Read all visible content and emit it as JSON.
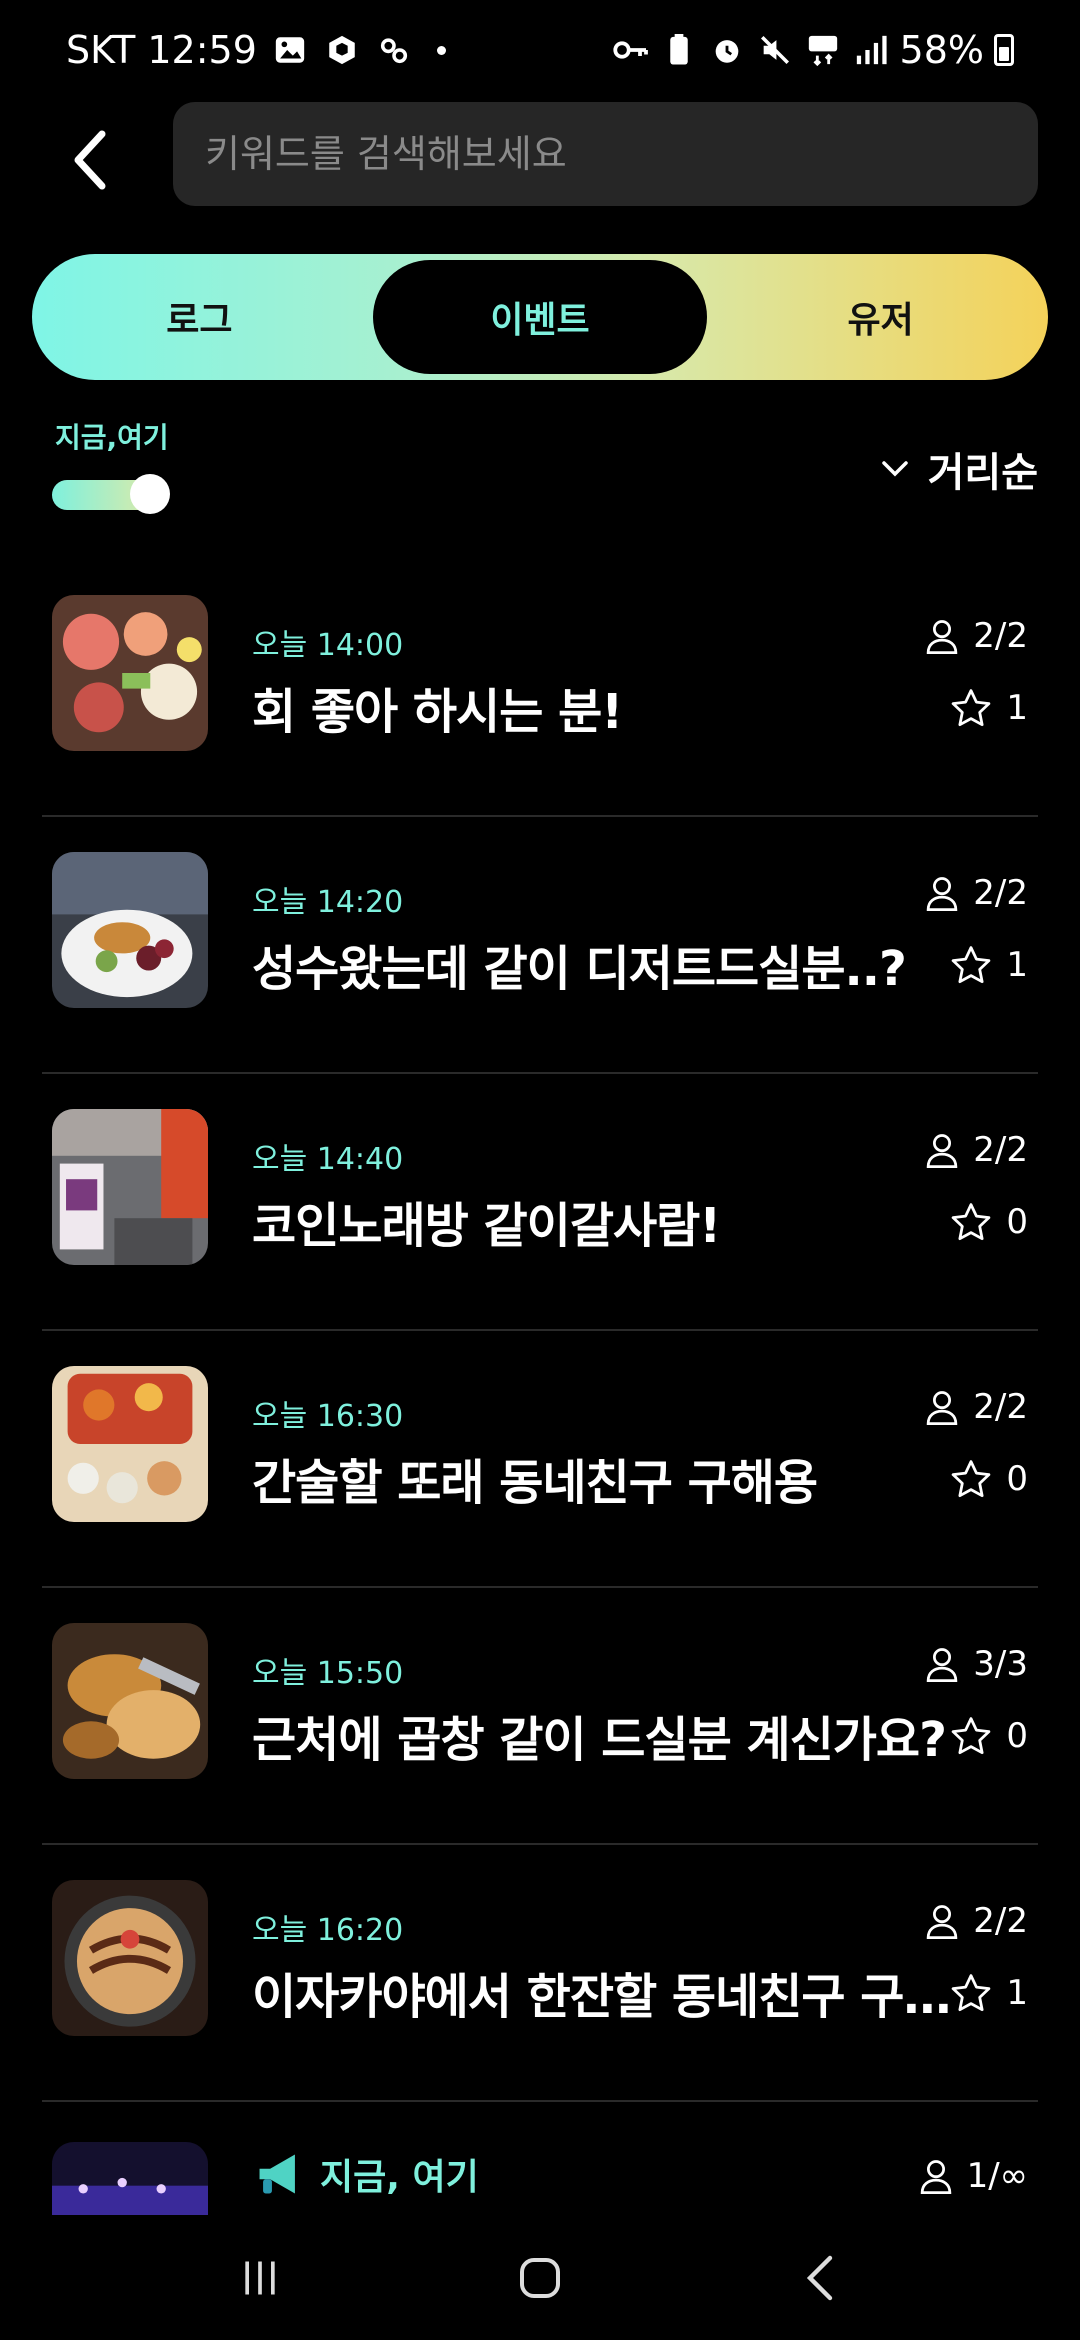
{
  "status_bar": {
    "carrier_time": "SKT 12:59",
    "battery": "58%"
  },
  "search": {
    "placeholder": "키워드를 검색해보세요"
  },
  "tabs": [
    {
      "label": "로그"
    },
    {
      "label": "이벤트",
      "active": true
    },
    {
      "label": "유저"
    }
  ],
  "filter": {
    "now_label": "지금,여기",
    "sort_label": "거리순"
  },
  "colors": {
    "accent": "#7ff0dd",
    "gradient_end": "#f4d25a"
  },
  "events": [
    {
      "time": "오늘 14:00",
      "title": "회 좋아 하시는 분!",
      "people": "2/2",
      "likes": "1"
    },
    {
      "time": "오늘 14:20",
      "title": "성수왔는데 같이 디저트드실분..?",
      "people": "2/2",
      "likes": "1"
    },
    {
      "time": "오늘 14:40",
      "title": "코인노래방 같이갈사람!",
      "people": "2/2",
      "likes": "0"
    },
    {
      "time": "오늘 16:30",
      "title": "간술할 또래 동네친구 구해용",
      "people": "2/2",
      "likes": "0"
    },
    {
      "time": "오늘 15:50",
      "title": "근처에 곱창 같이 드실분 계신가요?",
      "people": "3/3",
      "likes": "0"
    },
    {
      "time": "오늘 16:20",
      "title": "이자카야에서 한잔할 동네친구 구…",
      "people": "2/2",
      "likes": "1"
    }
  ],
  "partial_event": {
    "tag": "지금, 여기",
    "people": "1/∞"
  }
}
